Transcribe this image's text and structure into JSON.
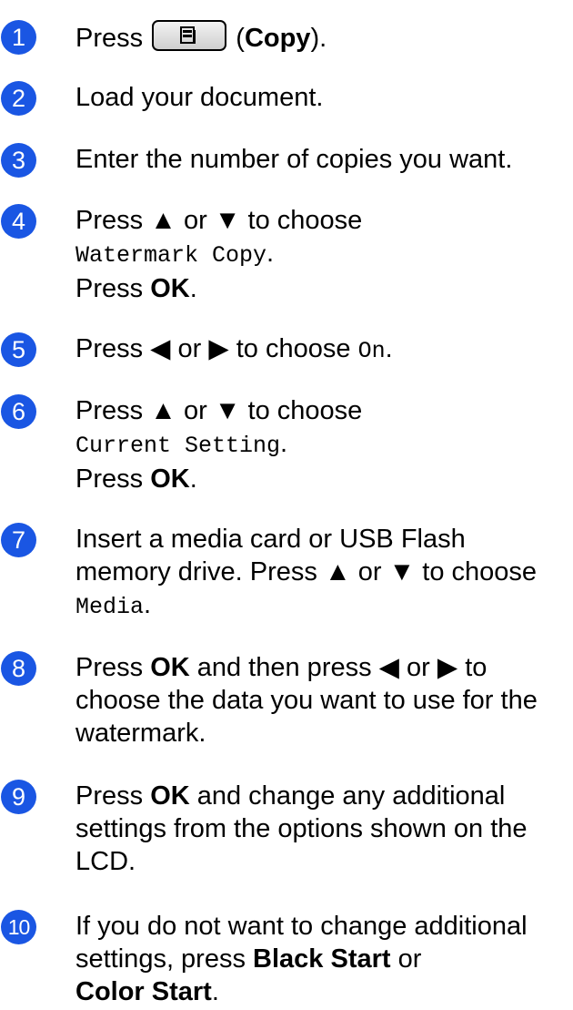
{
  "steps": [
    {
      "number": "1",
      "press": "Press",
      "paren_open": "(",
      "copy": "Copy",
      "paren_close": ")."
    },
    {
      "number": "2",
      "text": "Load your document."
    },
    {
      "number": "3",
      "text": "Enter the number of copies you want."
    },
    {
      "number": "4",
      "line1": "Press ▲ or ▼ to choose",
      "option": "Watermark Copy",
      "dot": ".",
      "press": "Press ",
      "ok": "OK",
      "end": "."
    },
    {
      "number": "5",
      "lead": "Press ◀ or ▶ to choose ",
      "option": "On",
      "end": "."
    },
    {
      "number": "6",
      "line1": "Press ▲ or ▼ to choose",
      "option": "Current Setting",
      "dot": ".",
      "press": "Press ",
      "ok": "OK",
      "end": "."
    },
    {
      "number": "7",
      "line1": "Insert a media card or USB Flash",
      "line2": "memory drive. Press ▲ or ▼ to choose",
      "option": "Media",
      "end": "."
    },
    {
      "number": "8",
      "press": "Press ",
      "ok": "OK",
      "line1_rest": " and then press ◀ or ▶ to",
      "line2": "choose the data you want to use for the",
      "line3": "watermark."
    },
    {
      "number": "9",
      "press": "Press ",
      "ok": "OK",
      "line1_rest": " and change any additional",
      "line2": "settings from the options shown on the",
      "line3": "LCD."
    },
    {
      "number": "10",
      "line1": "If you do not want to change additional",
      "line2_a": "settings, press ",
      "black_start": "Black Start",
      "line2_b": " or",
      "color_start": "Color Start",
      "end": "."
    }
  ],
  "icons": {
    "copy_button": "copy-document-icon"
  },
  "colors": {
    "badge": "#1a56e3"
  }
}
